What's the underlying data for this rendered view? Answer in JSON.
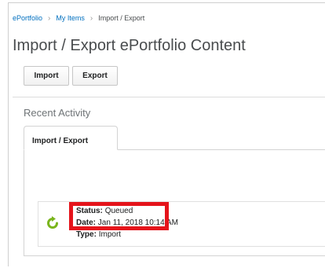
{
  "breadcrumb": {
    "items": [
      "ePortfolio",
      "My Items",
      "Import / Export"
    ],
    "separator": "›"
  },
  "page": {
    "title": "Import / Export ePortfolio Content"
  },
  "toolbar": {
    "import_label": "Import",
    "export_label": "Export"
  },
  "recent_activity": {
    "heading": "Recent Activity",
    "tab_label": "Import / Export",
    "item": {
      "icon": "refresh-arrow-icon",
      "status_label": "Status:",
      "status_value": "Queued",
      "date_label": "Date:",
      "date_value": "Jan 11, 2018 10:14 AM",
      "type_label": "Type:",
      "type_value": "Import"
    }
  },
  "colors": {
    "link": "#006fbf",
    "highlight": "#e5141b",
    "icon_green": "#7ab51d"
  }
}
